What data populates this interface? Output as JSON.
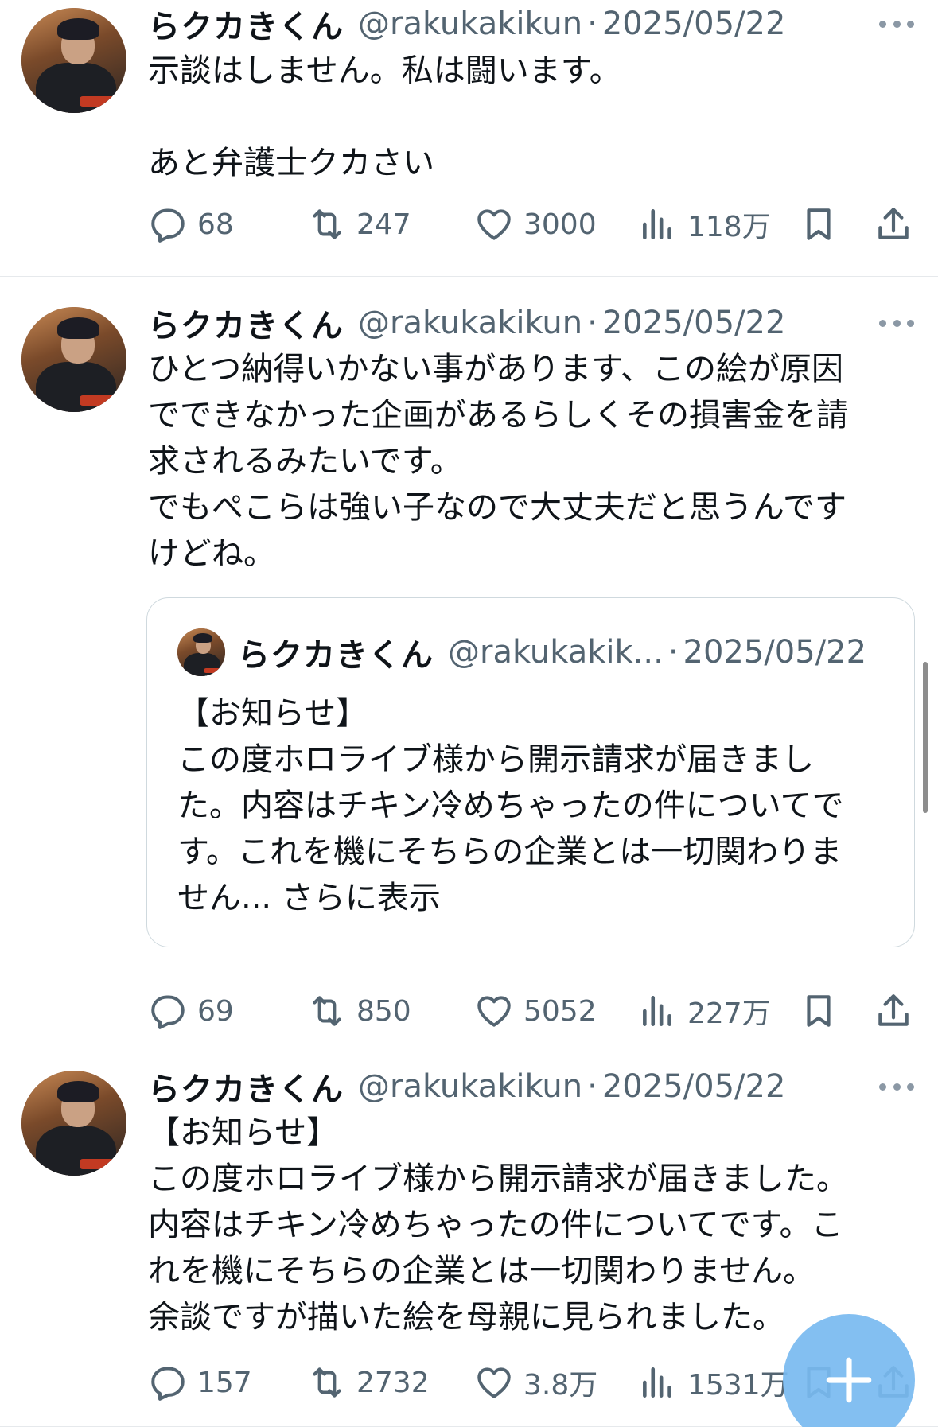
{
  "tweets": [
    {
      "author_name": "らクカきくん",
      "handle": "@rakukakikun",
      "separator": "·",
      "date": "2025/05/22",
      "text": "示談はしません。私は闘います。\n\nあと弁護士クカさい",
      "stats": {
        "replies": "68",
        "retweets": "247",
        "likes": "3000",
        "views": "118万"
      }
    },
    {
      "author_name": "らクカきくん",
      "handle": "@rakukakikun",
      "separator": "·",
      "date": "2025/05/22",
      "text": "ひとつ納得いかない事があります、この絵が原因\nでできなかった企画があるらしくその損害金を請\n求されるみたいです。\nでもぺこらは強い子なので大丈夫だと思うんです\nけどね。",
      "quote": {
        "author_name": "らクカきくん",
        "handle": "@rakukakik...",
        "separator": "·",
        "date": "2025/05/22",
        "text": "【お知らせ】\nこの度ホロライブ様から開示請求が届きまし\nた。内容はチキン冷めちゃったの件についてで\nす。これを機にそちらの企業とは一切関わりま\nせん... ",
        "show_more": "さらに表示"
      },
      "stats": {
        "replies": "69",
        "retweets": "850",
        "likes": "5052",
        "views": "227万"
      }
    },
    {
      "author_name": "らクカきくん",
      "handle": "@rakukakikun",
      "separator": "·",
      "date": "2025/05/22",
      "text": "【お知らせ】\nこの度ホロライブ様から開示請求が届きました。\n内容はチキン冷めちゃったの件についてです。こ\nれを機にそちらの企業とは一切関わりません。\n余談ですが描いた絵を母親に見られました。",
      "stats": {
        "replies": "157",
        "retweets": "2732",
        "likes": "3.8万",
        "views": "1531万"
      }
    }
  ],
  "icons": {
    "reply": "reply-icon",
    "retweet": "retweet-icon",
    "like": "like-icon",
    "views": "views-icon",
    "bookmark": "bookmark-icon",
    "share": "share-icon",
    "more": "more-icon",
    "compose": "compose-plus-icon"
  },
  "colors": {
    "text": "#0f1419",
    "secondary": "#536471",
    "fab": "#78baf0",
    "border": "#e6e9ec"
  }
}
